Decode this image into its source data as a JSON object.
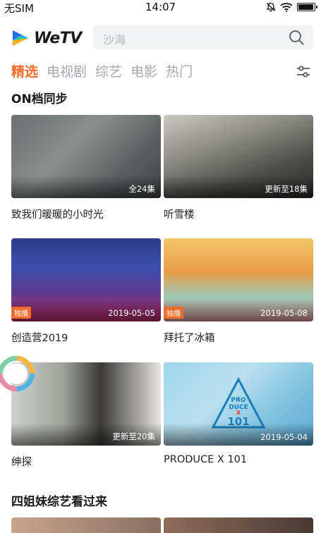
{
  "status_bar": {
    "carrier": "无SIM",
    "time": "14:07",
    "battery_level": 0.95
  },
  "header": {
    "app_name": "WeTV",
    "search_placeholder": "沙海"
  },
  "tabs": [
    {
      "label": "精选",
      "active": true
    },
    {
      "label": "电视剧",
      "active": false
    },
    {
      "label": "综艺",
      "active": false
    },
    {
      "label": "电影",
      "active": false
    },
    {
      "label": "热门",
      "active": false
    }
  ],
  "sections": [
    {
      "title": "ON档同步",
      "cards": [
        {
          "title": "致我们暖暖的小时光",
          "badge": "全24集",
          "tag": ""
        },
        {
          "title": "听雪楼",
          "badge": "更新至18集",
          "tag": ""
        },
        {
          "title": "创造营2019",
          "badge": "2019-05-05",
          "tag": "独播"
        },
        {
          "title": "拜托了冰箱",
          "badge": "2019-05-08",
          "tag": "独播"
        },
        {
          "title": "绅探",
          "badge": "更新至20集",
          "tag": ""
        },
        {
          "title": "PRODUCE X 101",
          "badge": "2019-05-04",
          "tag": ""
        }
      ]
    },
    {
      "title": "四姐妹综艺看过来"
    }
  ],
  "produce_logo": {
    "line1": "PRO",
    "line2": "DUCE",
    "line3": "X",
    "line4": "101"
  },
  "colors": {
    "accent": "#f26b2a",
    "tab_inactive": "#a3a7ae",
    "search_bg": "#f2f3f5"
  },
  "icons": {
    "search": "search-icon",
    "filter": "filter-icon",
    "bell_muted": "bell-muted-icon",
    "wifi": "wifi-icon",
    "battery": "battery-icon",
    "loading": "loading-spinner-icon"
  }
}
